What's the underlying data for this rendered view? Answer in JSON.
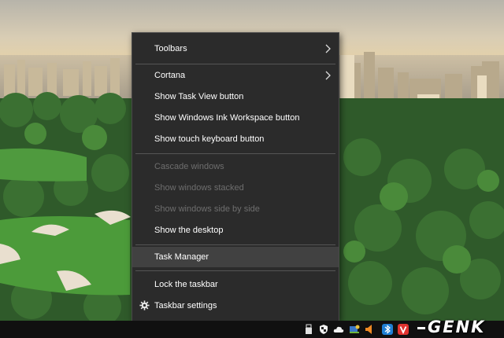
{
  "menu": {
    "items": [
      {
        "label": "Toolbars",
        "submenu": true
      },
      {
        "label": "Cortana",
        "submenu": true
      },
      {
        "label": "Show Task View button"
      },
      {
        "label": "Show Windows Ink Workspace button"
      },
      {
        "label": "Show touch keyboard button"
      },
      {
        "label": "Cascade windows",
        "disabled": true
      },
      {
        "label": "Show windows stacked",
        "disabled": true
      },
      {
        "label": "Show windows side by side",
        "disabled": true
      },
      {
        "label": "Show the desktop"
      },
      {
        "label": "Task Manager",
        "highlighted": true
      },
      {
        "label": "Lock the taskbar"
      },
      {
        "label": "Taskbar settings",
        "icon": "gear-icon"
      }
    ]
  },
  "tray": {
    "icons": [
      "usb-device-icon",
      "security-shield-icon",
      "onedrive-cloud-icon",
      "network-icon",
      "volume-icon",
      "bluetooth-app-icon",
      "vivaldi-icon"
    ]
  },
  "watermark": {
    "text": "GENK"
  },
  "colors": {
    "menu_bg": "#2b2b2b",
    "menu_highlight": "#414141",
    "menu_text": "#ffffff",
    "menu_disabled_text": "#6e6e6e",
    "taskbar": "#101010"
  }
}
